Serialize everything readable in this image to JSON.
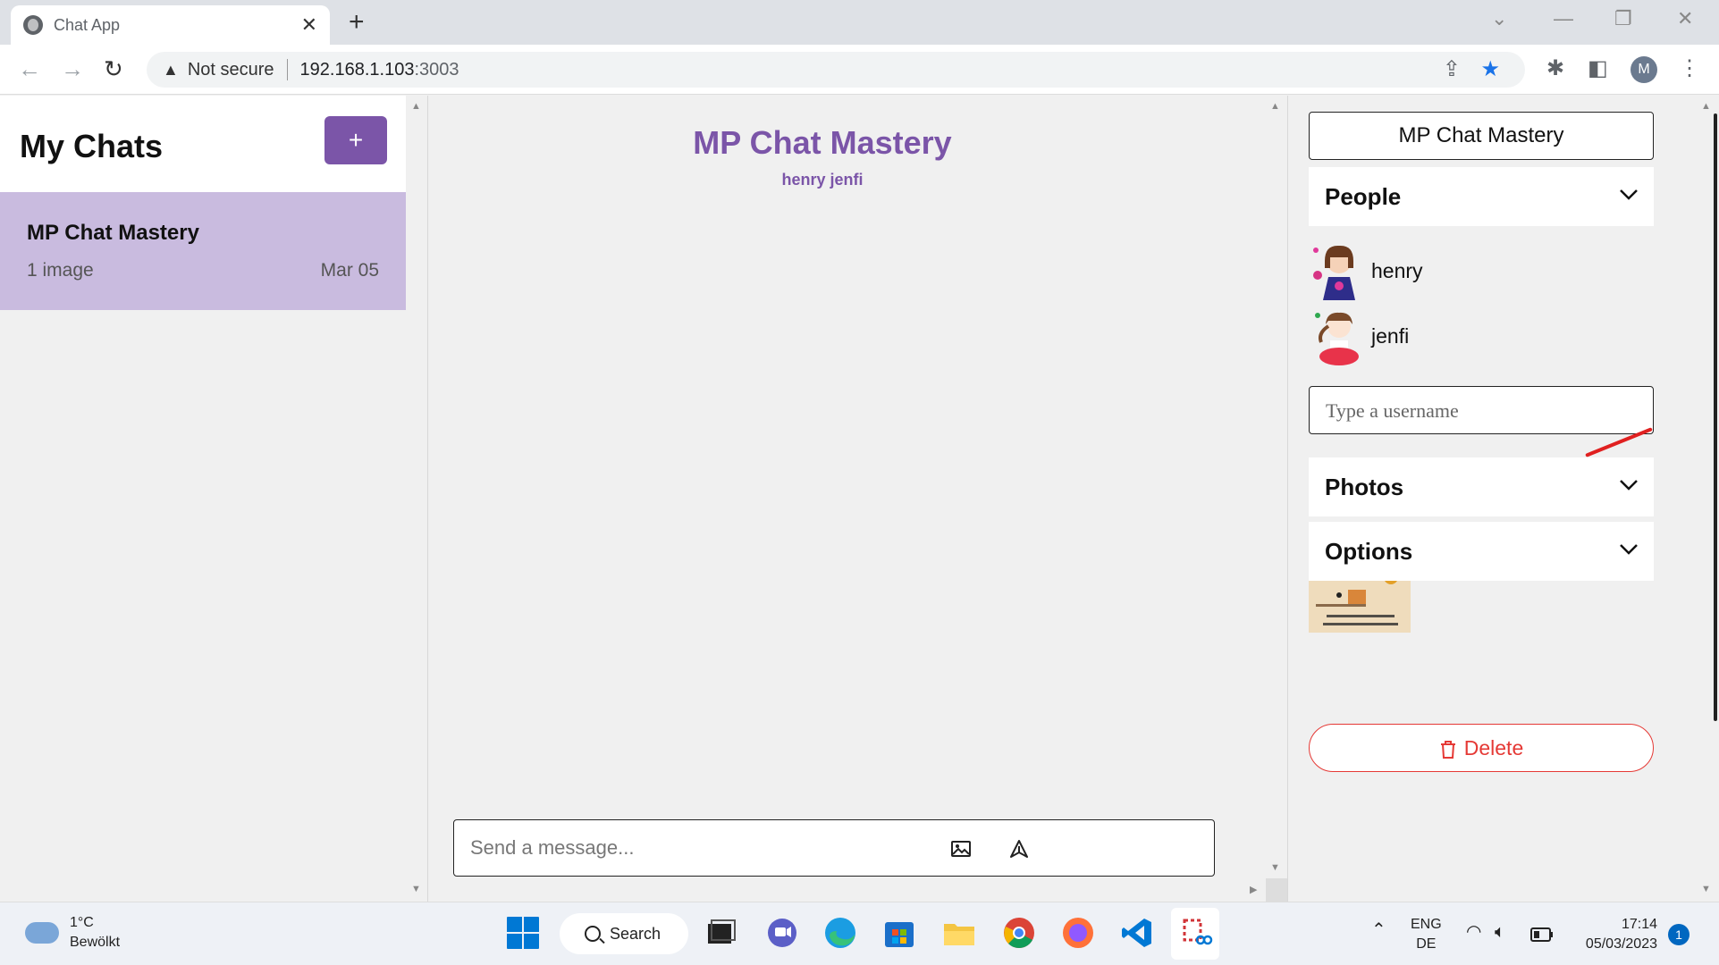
{
  "browser": {
    "tab_title": "Chat App",
    "security_label": "Not secure",
    "url_host": "192.168.1.103",
    "url_port": ":3003",
    "profile_initial": "M"
  },
  "sidebar": {
    "heading": "My Chats",
    "add_label": "+",
    "chats": [
      {
        "title": "MP Chat Mastery",
        "last_message": "1 image",
        "date": "Mar 05"
      }
    ]
  },
  "chat": {
    "title": "MP Chat Mastery",
    "members_line": "henry jenfi",
    "message_placeholder": "Send a message..."
  },
  "settings": {
    "chat_title": "MP Chat Mastery",
    "people_label": "People",
    "people": [
      {
        "name": "henry"
      },
      {
        "name": "jenfi"
      }
    ],
    "username_placeholder": "Type a username",
    "photos_label": "Photos",
    "photo_caption": "Don't work hard. Work intelligent.",
    "options_label": "Options",
    "delete_label": "Delete"
  },
  "taskbar": {
    "temperature": "1°C",
    "weather_text": "Bewölkt",
    "search_label": "Search",
    "language": "ENG",
    "region": "DE",
    "time": "17:14",
    "date": "05/03/2023",
    "notification_count": "1"
  },
  "colors": {
    "accent": "#7b55a8",
    "selected_chat": "#c9bbdf",
    "danger": "#e53935"
  }
}
